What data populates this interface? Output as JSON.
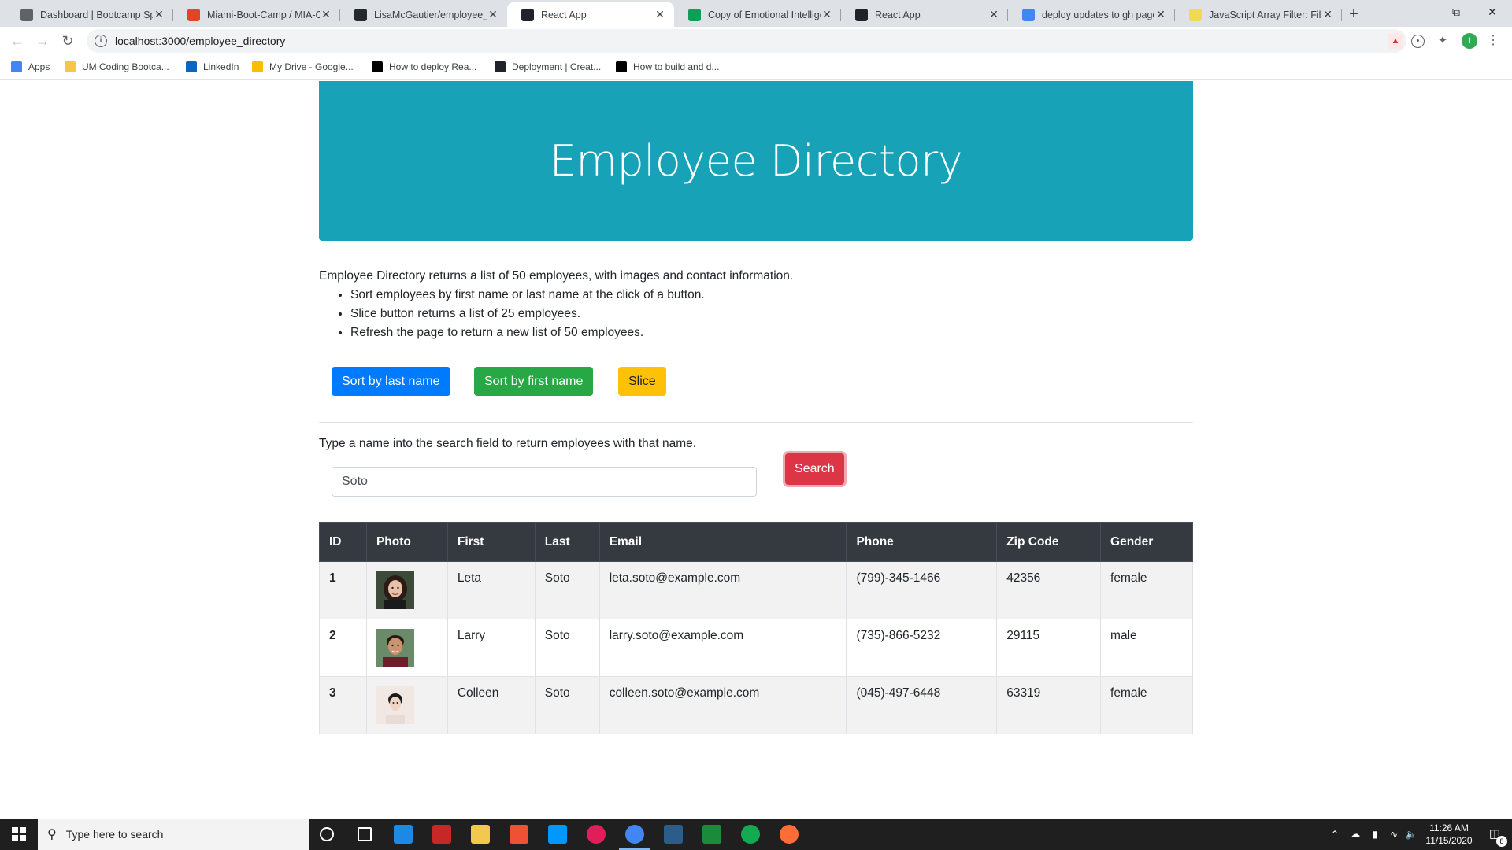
{
  "browser": {
    "tabs": [
      {
        "title": "Dashboard | Bootcamp Spot",
        "icon": "bootcampspot-icon",
        "color": "#5f6368",
        "active": false
      },
      {
        "title": "Miami-Boot-Camp / MIA-COD",
        "icon": "gitlab-icon",
        "color": "#e24329",
        "active": false
      },
      {
        "title": "LisaMcGautier/employee_dir",
        "icon": "github-icon",
        "color": "#24292e",
        "active": false
      },
      {
        "title": "React App",
        "icon": "react-icon",
        "color": "#20232a",
        "active": true
      },
      {
        "title": "Copy of Emotional Intelligence",
        "icon": "sheets-icon",
        "color": "#0f9d58",
        "active": false
      },
      {
        "title": "React App",
        "icon": "react-icon",
        "color": "#20232a",
        "active": false
      },
      {
        "title": "deploy updates to gh pages",
        "icon": "google-icon",
        "color": "#4285f4",
        "active": false
      },
      {
        "title": "JavaScript Array Filter: Filter",
        "icon": "js-icon",
        "color": "#f0db4f",
        "active": false
      }
    ],
    "url": "localhost:3000/employee_directory",
    "bookmarks": [
      {
        "label": "Apps",
        "icon": "apps-grid-icon",
        "color": "#4285f4"
      },
      {
        "label": "UM Coding Bootca...",
        "icon": "folder-icon",
        "color": "#f6c744"
      },
      {
        "label": "LinkedIn",
        "icon": "linkedin-icon",
        "color": "#0a66c2"
      },
      {
        "label": "My Drive - Google...",
        "icon": "google-drive-icon",
        "color": "#fbbc04"
      },
      {
        "label": "How to deploy Rea...",
        "icon": "dev-icon",
        "color": "#000000"
      },
      {
        "label": "Deployment | Creat...",
        "icon": "cra-icon",
        "color": "#20232a"
      },
      {
        "label": "How to build and d...",
        "icon": "medium-icon",
        "color": "#000000"
      }
    ],
    "profile_initial": "I"
  },
  "header": {
    "title": "Employee Directory",
    "accent": "#17a2b8"
  },
  "intro": {
    "text": "Employee Directory returns a list of 50 employees, with images and contact information.",
    "bullets": [
      "Sort employees by first name or last name at the click of a button.",
      "Slice button returns a list of 25 employees.",
      "Refresh the page to return a new list of 50 employees."
    ]
  },
  "buttons": {
    "sort_last": "Sort by last name",
    "sort_first": "Sort by first name",
    "slice": "Slice"
  },
  "search": {
    "hint": "Type a name into the search field to return employees with that name.",
    "value": "Soto",
    "button": "Search"
  },
  "table": {
    "headers": [
      "ID",
      "Photo",
      "First",
      "Last",
      "Email",
      "Phone",
      "Zip Code",
      "Gender"
    ],
    "rows": [
      {
        "id": "1",
        "first": "Leta",
        "last": "Soto",
        "email": "leta.soto@example.com",
        "phone": "(799)-345-1466",
        "zip": "42356",
        "gender": "female"
      },
      {
        "id": "2",
        "first": "Larry",
        "last": "Soto",
        "email": "larry.soto@example.com",
        "phone": "(735)-866-5232",
        "zip": "29115",
        "gender": "male"
      },
      {
        "id": "3",
        "first": "Colleen",
        "last": "Soto",
        "email": "colleen.soto@example.com",
        "phone": "(045)-497-6448",
        "zip": "63319",
        "gender": "female"
      }
    ]
  },
  "taskbar": {
    "search_placeholder": "Type here to search",
    "apps": [
      "cortana-icon",
      "task-view-icon",
      "lastpass-icon",
      "mcafee-icon",
      "file-explorer-icon",
      "git-icon",
      "vscode-icon",
      "slack-icon",
      "chrome-icon",
      "mysql-workbench-icon",
      "robo3t-icon",
      "mongodb-compass-icon",
      "postman-icon"
    ],
    "time": "11:26 AM",
    "date": "11/15/2020",
    "notifications": "8"
  }
}
